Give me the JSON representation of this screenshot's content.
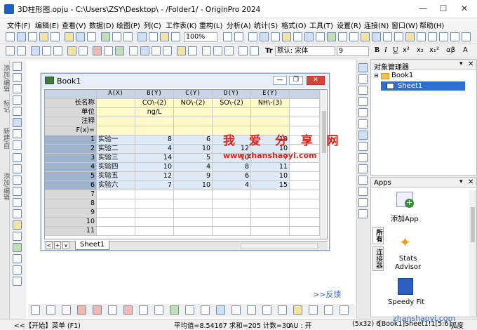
{
  "window": {
    "title": "3D柱形图.opju - C:\\Users\\ZSY\\Desktop\\ - /Folder1/ - OriginPro 2024"
  },
  "menu": [
    "文件(F)",
    "编辑(E)",
    "查看(V)",
    "数据(D)",
    "绘图(P)",
    "列(C)",
    "工作表(K)",
    "重构(L)",
    "分析(A)",
    "统计(S)",
    "格式(O)",
    "工具(T)",
    "设置(R)",
    "连接(N)",
    "窗口(W)",
    "帮助(H)"
  ],
  "toolbar": {
    "zoom": "100%",
    "default_font_label": "默认: 宋体",
    "font_size": "9",
    "font_style": [
      "B",
      "I",
      "U",
      "x²",
      "x₂",
      "x₁²",
      "αβ",
      "A"
    ]
  },
  "left_labels": [
    "添加/编辑",
    "标记",
    "新建/自",
    "添加/编辑"
  ],
  "book": {
    "title": "Book1",
    "columns": [
      "A(X)",
      "B(Y)",
      "C(Y)",
      "D(Y)",
      "E(Y)"
    ],
    "meta_labels": [
      "长名称",
      "单位",
      "注释",
      "F(x)="
    ],
    "long_names": [
      "",
      "CO\\-(2)",
      "NO\\-(2)",
      "SO\\-(2)",
      "NH\\-(3)"
    ],
    "units": [
      "",
      "ng/L",
      "",
      "",
      ""
    ],
    "rows": [
      {
        "n": "1",
        "a": "实验一",
        "b": "8",
        "c": "6",
        "d": "",
        "e": "10"
      },
      {
        "n": "2",
        "a": "实验二",
        "b": "4",
        "c": "10",
        "d": "12",
        "e": "10"
      },
      {
        "n": "3",
        "a": "实验三",
        "b": "14",
        "c": "5",
        "d": "10",
        "e": "7"
      },
      {
        "n": "4",
        "a": "实验四",
        "b": "10",
        "c": "4",
        "d": "8",
        "e": "11"
      },
      {
        "n": "5",
        "a": "实验五",
        "b": "12",
        "c": "9",
        "d": "6",
        "e": "10"
      },
      {
        "n": "6",
        "a": "实验六",
        "b": "7",
        "c": "10",
        "d": "4",
        "e": "15"
      },
      {
        "n": "7",
        "a": "",
        "b": "",
        "c": "",
        "d": "",
        "e": ""
      },
      {
        "n": "8",
        "a": "",
        "b": "",
        "c": "",
        "d": "",
        "e": ""
      },
      {
        "n": "9",
        "a": "",
        "b": "",
        "c": "",
        "d": "",
        "e": ""
      },
      {
        "n": "10",
        "a": "",
        "b": "",
        "c": "",
        "d": "",
        "e": ""
      },
      {
        "n": "11",
        "a": "",
        "b": "",
        "c": "",
        "d": "",
        "e": ""
      }
    ],
    "sheet_tab": "Sheet1",
    "nav_buttons": [
      "<",
      "+",
      "∨"
    ]
  },
  "watermark": {
    "line1": "我 爱 分 享 网",
    "line2": "www.zhanshaoyi.com"
  },
  "feedback": ">>反馈",
  "object_manager": {
    "title": "对象管理器",
    "book": "Book1",
    "sheet": "Sheet1"
  },
  "apps": {
    "title": "Apps",
    "vtabs": [
      "所有",
      "连接器"
    ],
    "items": [
      {
        "label": "添加App",
        "color": "#3a8f3a"
      },
      {
        "label": "Stats\nAdvisor",
        "color": "#e0a020"
      },
      {
        "label": "Speedy Fit",
        "color": "#2a5fbf"
      }
    ]
  },
  "statusbar": {
    "start": "<<【开始】菜单 (F1)",
    "stats": "平均值=8.54167 求和=205 计数=30",
    "au": "AU : 开",
    "pos": "(5x32) 6",
    "sheet": "[Book1]Sheet1!1[5:6]",
    "unit": "弧度"
  },
  "watermark_bottom": "zhanshaoyi.com"
}
